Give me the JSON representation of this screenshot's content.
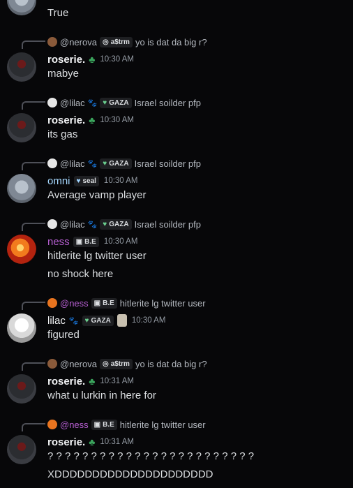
{
  "messages": [
    {
      "reply": null,
      "author": null,
      "timestamp": null,
      "lines": [
        "True"
      ]
    },
    {
      "reply": {
        "name": "@nerova",
        "tag": "a$trm",
        "tag_icon": "wreath-icon",
        "text": "yo is dat da big r?"
      },
      "author": "roserie.",
      "author_badge": "clover-icon",
      "timestamp": "10:30 AM",
      "lines": [
        "mabye"
      ]
    },
    {
      "reply": {
        "name": "@lilac",
        "tag": "GAZA",
        "tag_icon": "heart-icon",
        "text": "Israel soilder pfp"
      },
      "author": "roserie.",
      "author_badge": "clover-icon",
      "timestamp": "10:30 AM",
      "lines": [
        "its gas"
      ]
    },
    {
      "reply": {
        "name": "@lilac",
        "tag": "GAZA",
        "tag_icon": "heart-icon",
        "text": "Israel soilder pfp"
      },
      "author": "omni",
      "author_tag": "seal",
      "author_tag_icon": "heart-icon",
      "timestamp": "10:30 AM",
      "lines": [
        "Average vamp player"
      ]
    },
    {
      "reply": {
        "name": "@lilac",
        "tag": "GAZA",
        "tag_icon": "heart-icon",
        "text": "Israel soilder pfp"
      },
      "author": "ness",
      "author_tag": "B.E",
      "author_tag_icon": "badge-icon",
      "timestamp": "10:30 AM",
      "lines": [
        "hitlerite lg twitter user",
        "no shock here"
      ]
    },
    {
      "reply": {
        "name": "@ness",
        "tag": "B.E",
        "tag_icon": "badge-icon",
        "text": "hitlerite lg twitter user"
      },
      "author": "lilac",
      "author_tag": "GAZA",
      "author_tag_icon": "heart-icon",
      "timestamp": "10:30 AM",
      "lines": [
        "figured"
      ]
    },
    {
      "reply": {
        "name": "@nerova",
        "tag": "a$trm",
        "tag_icon": "wreath-icon",
        "text": "yo is dat da big r?"
      },
      "author": "roserie.",
      "author_badge": "clover-icon",
      "timestamp": "10:31 AM",
      "lines": [
        "what u lurkin in here for"
      ]
    },
    {
      "reply": {
        "name": "@ness",
        "tag": "B.E",
        "tag_icon": "badge-icon",
        "text": "hitlerite lg twitter user"
      },
      "author": "roserie.",
      "author_badge": "clover-icon",
      "timestamp": "10:31 AM",
      "lines": [
        "? ? ? ? ? ? ? ? ? ? ? ? ? ? ? ? ? ? ? ? ? ? ? ?",
        "XDDDDDDDDDDDDDDDDDDDDD"
      ]
    }
  ],
  "colors": {
    "background": "#070709",
    "ness_name": "#b65fd1",
    "omni_name": "#a6d8ff",
    "leaf": "#3ba55d",
    "nerova_name": "#b5bac1"
  }
}
